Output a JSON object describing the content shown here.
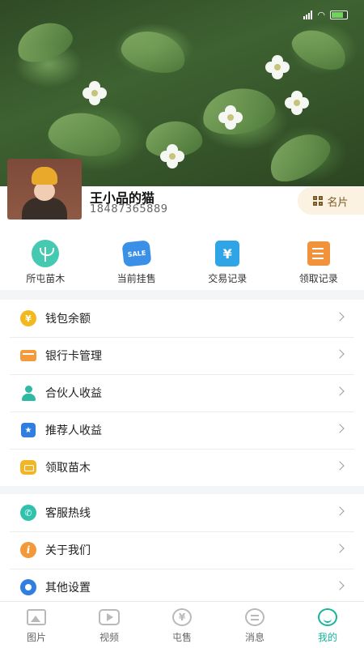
{
  "status": {
    "battery": "59"
  },
  "profile": {
    "name": "王小品的猫",
    "phone": "18487365889",
    "card_label": "名片"
  },
  "quick_actions": [
    {
      "label": "所屯苗木",
      "icon": "sapling-icon"
    },
    {
      "label": "当前挂售",
      "icon": "sale-tag-icon",
      "badge": "SALE"
    },
    {
      "label": "交易记录",
      "icon": "yen-receipt-icon",
      "glyph": "¥"
    },
    {
      "label": "领取记录",
      "icon": "note-edit-icon"
    }
  ],
  "menu_primary": [
    {
      "label": "钱包余额",
      "icon": "coin-icon",
      "glyph": "¥"
    },
    {
      "label": "银行卡管理",
      "icon": "bank-card-icon"
    },
    {
      "label": "合伙人收益",
      "icon": "partner-icon"
    },
    {
      "label": "推荐人收益",
      "icon": "star-badge-icon",
      "glyph": "★"
    },
    {
      "label": "领取苗木",
      "icon": "wallet-icon"
    }
  ],
  "menu_secondary": [
    {
      "label": "客服热线",
      "icon": "phone-icon",
      "glyph": "✆"
    },
    {
      "label": "关于我们",
      "icon": "info-icon",
      "glyph": "i"
    },
    {
      "label": "其他设置",
      "icon": "gear-icon"
    }
  ],
  "tabbar": [
    {
      "label": "图片",
      "icon": "picture-icon"
    },
    {
      "label": "视频",
      "icon": "video-icon"
    },
    {
      "label": "屯售",
      "icon": "yen-circle-icon",
      "glyph": "¥"
    },
    {
      "label": "消息",
      "icon": "message-icon"
    },
    {
      "label": "我的",
      "icon": "profile-smile-icon",
      "active": true
    }
  ],
  "colors": {
    "accent": "#18b39a",
    "card_bg": "#fbf2e1"
  }
}
